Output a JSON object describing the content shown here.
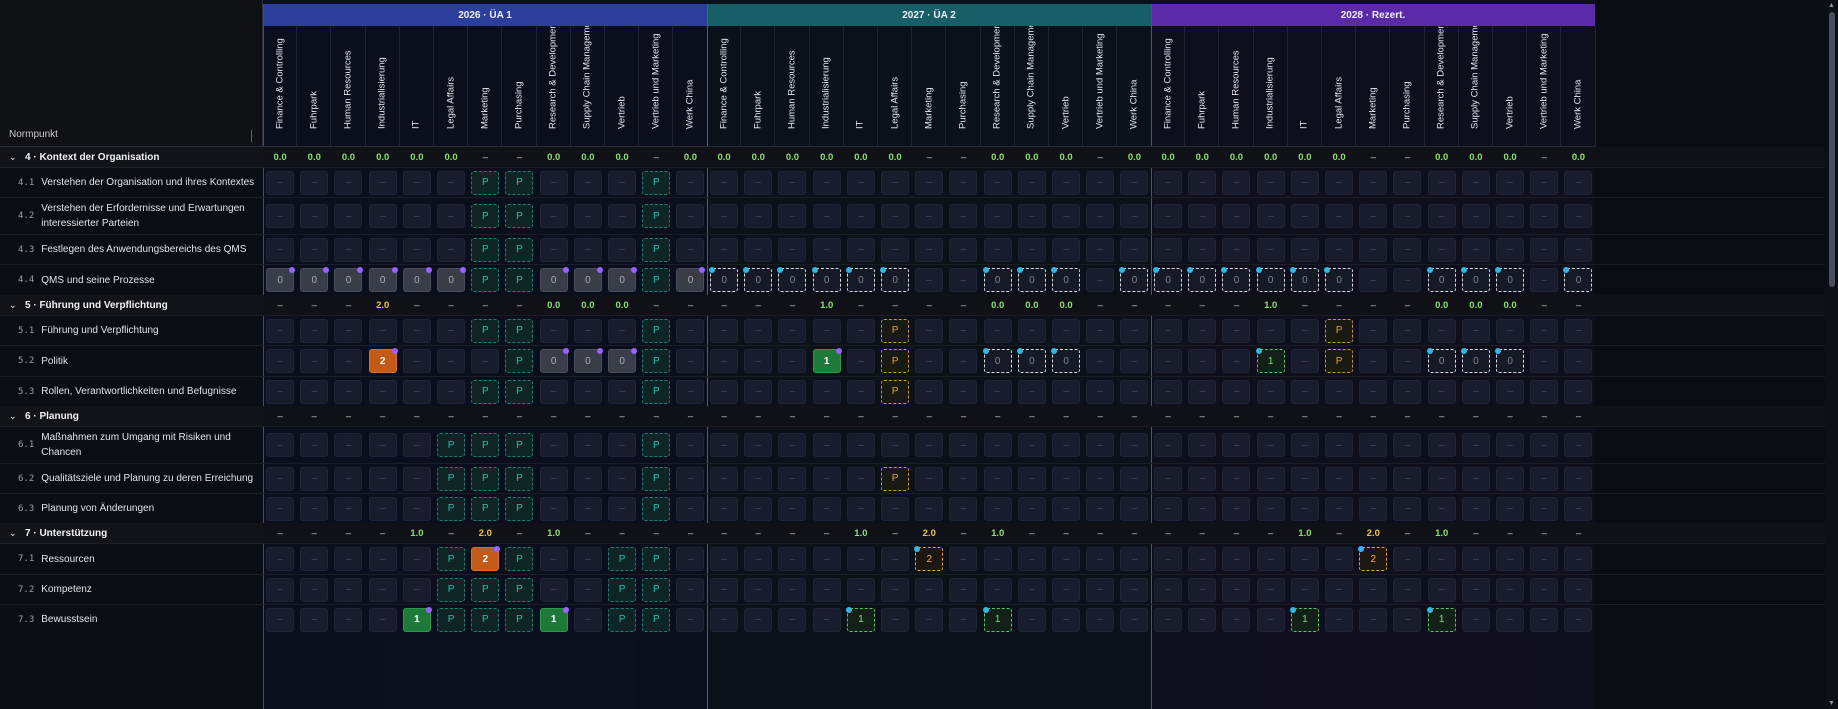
{
  "corner_label": "Normpunkt",
  "groups": [
    {
      "label": "2026 · ÜA 1",
      "color": "#2b3e9c",
      "tint": "rgba(40,70,180,0.06)",
      "line": "#2d4bb8"
    },
    {
      "label": "2027 · ÜA 2",
      "color": "#175e66",
      "tint": "rgba(20,110,120,0.06)",
      "line": "#1b7780"
    },
    {
      "label": "2028 · Rezert.",
      "color": "#5a2aa8",
      "tint": "rgba(110,50,190,0.06)",
      "line": "#6c34c4"
    }
  ],
  "columns": [
    "Finance & Controlling",
    "Fuhrpark",
    "Human Resources",
    "Industrialisierung",
    "IT",
    "Legal Affairs",
    "Marketing",
    "Purchasing",
    "Research & Development",
    "Supply Chain Management",
    "Vertrieb",
    "Vertrieb und Marketing",
    "Werk China"
  ],
  "rows": [
    {
      "type": "section",
      "label": "4 · Kontext der Organisation",
      "g": [
        [
          "0.0",
          "0.0",
          "0.0",
          "0.0",
          "0.0",
          "0.0",
          "–",
          "–",
          "0.0",
          "0.0",
          "0.0",
          "–",
          "0.0"
        ],
        [
          "0.0",
          "0.0",
          "0.0",
          "0.0",
          "0.0",
          "0.0",
          "–",
          "–",
          "0.0",
          "0.0",
          "0.0",
          "–",
          "0.0"
        ],
        [
          "0.0",
          "0.0",
          "0.0",
          "0.0",
          "0.0",
          "0.0",
          "–",
          "–",
          "0.0",
          "0.0",
          "0.0",
          "–",
          "0.0"
        ]
      ]
    },
    {
      "type": "item",
      "num": "4.1",
      "label": "Verstehen der Organisation und ihres Kontextes",
      "h": 30,
      "g": [
        [
          "e",
          "e",
          "e",
          "e",
          "e",
          "e",
          "p",
          "p",
          "e",
          "e",
          "e",
          "p",
          "e"
        ],
        [
          "e",
          "e",
          "e",
          "e",
          "e",
          "e",
          "e",
          "e",
          "e",
          "e",
          "e",
          "e",
          "e"
        ],
        [
          "e",
          "e",
          "e",
          "e",
          "e",
          "e",
          "e",
          "e",
          "e",
          "e",
          "e",
          "e",
          "e"
        ]
      ]
    },
    {
      "type": "item",
      "num": "4.2",
      "label": "Verstehen der Erfordernisse und Erwartungen interessierter Parteien",
      "h": 37,
      "g": [
        [
          "e",
          "e",
          "e",
          "e",
          "e",
          "e",
          "p",
          "p",
          "e",
          "e",
          "e",
          "p",
          "e"
        ],
        [
          "e",
          "e",
          "e",
          "e",
          "e",
          "e",
          "e",
          "e",
          "e",
          "e",
          "e",
          "e",
          "e"
        ],
        [
          "e",
          "e",
          "e",
          "e",
          "e",
          "e",
          "e",
          "e",
          "e",
          "e",
          "e",
          "e",
          "e"
        ]
      ]
    },
    {
      "type": "item",
      "num": "4.3",
      "label": "Festlegen des Anwendungsbereichs des QMS",
      "h": 30,
      "g": [
        [
          "e",
          "e",
          "e",
          "e",
          "e",
          "e",
          "p",
          "p",
          "e",
          "e",
          "e",
          "p",
          "e"
        ],
        [
          "e",
          "e",
          "e",
          "e",
          "e",
          "e",
          "e",
          "e",
          "e",
          "e",
          "e",
          "e",
          "e"
        ],
        [
          "e",
          "e",
          "e",
          "e",
          "e",
          "e",
          "e",
          "e",
          "e",
          "e",
          "e",
          "e",
          "e"
        ]
      ]
    },
    {
      "type": "item",
      "num": "4.4",
      "label": "QMS und seine Prozesse",
      "h": 31,
      "g": [
        [
          "z",
          "z",
          "z",
          "z",
          "z",
          "z",
          "p",
          "p",
          "z",
          "z",
          "z",
          "p",
          "z"
        ],
        [
          "zd",
          "zd",
          "zd",
          "zd",
          "zd",
          "zd",
          "e",
          "e",
          "zd",
          "zd",
          "zd",
          "e",
          "zd"
        ],
        [
          "zd",
          "zd",
          "zd",
          "zd",
          "zd",
          "zd",
          "e",
          "e",
          "zd",
          "zd",
          "zd",
          "e",
          "zd"
        ]
      ]
    },
    {
      "type": "section",
      "label": "5 · Führung und Verpflichtung",
      "g": [
        [
          "–",
          "–",
          "–",
          "2.0",
          "–",
          "–",
          "–",
          "–",
          "0.0",
          "0.0",
          "0.0",
          "–",
          "–"
        ],
        [
          "–",
          "–",
          "–",
          "1.0",
          "–",
          "–",
          "–",
          "–",
          "0.0",
          "0.0",
          "0.0",
          "–",
          "–"
        ],
        [
          "–",
          "–",
          "–",
          "1.0",
          "–",
          "–",
          "–",
          "–",
          "0.0",
          "0.0",
          "0.0",
          "–",
          "–"
        ]
      ]
    },
    {
      "type": "item",
      "num": "5.1",
      "label": "Führung und Verpflichtung",
      "h": 30,
      "g": [
        [
          "e",
          "e",
          "e",
          "e",
          "e",
          "e",
          "p",
          "p",
          "e",
          "e",
          "e",
          "p",
          "e"
        ],
        [
          "e",
          "e",
          "e",
          "e",
          "e",
          "py",
          "e",
          "e",
          "e",
          "e",
          "e",
          "e",
          "e"
        ],
        [
          "e",
          "e",
          "e",
          "e",
          "e",
          "py",
          "e",
          "e",
          "e",
          "e",
          "e",
          "e",
          "e"
        ]
      ]
    },
    {
      "type": "item",
      "num": "5.2",
      "label": "Politik",
      "h": 31,
      "g": [
        [
          "e",
          "e",
          "e",
          "two",
          "e",
          "e",
          "e",
          "p",
          "z",
          "z",
          "z",
          "p",
          "e"
        ],
        [
          "e",
          "e",
          "e",
          "one",
          "e",
          "py",
          "e",
          "e",
          "zd",
          "zd",
          "zd",
          "e",
          "e"
        ],
        [
          "e",
          "e",
          "e",
          "d1",
          "e",
          "py",
          "e",
          "e",
          "zd",
          "zd",
          "zd",
          "e",
          "e"
        ]
      ]
    },
    {
      "type": "item",
      "num": "5.3",
      "label": "Rollen, Verantwortlichkeiten und Befugnisse",
      "h": 30,
      "g": [
        [
          "e",
          "e",
          "e",
          "e",
          "e",
          "e",
          "p",
          "p",
          "e",
          "e",
          "e",
          "p",
          "e"
        ],
        [
          "e",
          "e",
          "e",
          "e",
          "e",
          "py",
          "e",
          "e",
          "e",
          "e",
          "e",
          "e",
          "e"
        ],
        [
          "e",
          "e",
          "e",
          "e",
          "e",
          "e",
          "e",
          "e",
          "e",
          "e",
          "e",
          "e",
          "e"
        ]
      ]
    },
    {
      "type": "section",
      "label": "6 · Planung",
      "g": [
        [
          "–",
          "–",
          "–",
          "–",
          "–",
          "–",
          "–",
          "–",
          "–",
          "–",
          "–",
          "–",
          "–"
        ],
        [
          "–",
          "–",
          "–",
          "–",
          "–",
          "–",
          "–",
          "–",
          "–",
          "–",
          "–",
          "–",
          "–"
        ],
        [
          "–",
          "–",
          "–",
          "–",
          "–",
          "–",
          "–",
          "–",
          "–",
          "–",
          "–",
          "–",
          "–"
        ]
      ]
    },
    {
      "type": "item",
      "num": "6.1",
      "label": "Maßnahmen zum Umgang mit Risiken und Chancen",
      "h": 37,
      "g": [
        [
          "e",
          "e",
          "e",
          "e",
          "e",
          "p",
          "p",
          "p",
          "e",
          "e",
          "e",
          "p",
          "e"
        ],
        [
          "e",
          "e",
          "e",
          "e",
          "e",
          "e",
          "e",
          "e",
          "e",
          "e",
          "e",
          "e",
          "e"
        ],
        [
          "e",
          "e",
          "e",
          "e",
          "e",
          "e",
          "e",
          "e",
          "e",
          "e",
          "e",
          "e",
          "e"
        ]
      ]
    },
    {
      "type": "item",
      "num": "6.2",
      "label": "Qualitätsziele und Planung zu deren Erreichung",
      "h": 30,
      "g": [
        [
          "e",
          "e",
          "e",
          "e",
          "e",
          "p",
          "p",
          "p",
          "e",
          "e",
          "e",
          "p",
          "e"
        ],
        [
          "e",
          "e",
          "e",
          "e",
          "e",
          "py",
          "e",
          "e",
          "e",
          "e",
          "e",
          "e",
          "e"
        ],
        [
          "e",
          "e",
          "e",
          "e",
          "e",
          "e",
          "e",
          "e",
          "e",
          "e",
          "e",
          "e",
          "e"
        ]
      ]
    },
    {
      "type": "item",
      "num": "6.3",
      "label": "Planung von Änderungen",
      "h": 30,
      "g": [
        [
          "e",
          "e",
          "e",
          "e",
          "e",
          "p",
          "p",
          "p",
          "e",
          "e",
          "e",
          "p",
          "e"
        ],
        [
          "e",
          "e",
          "e",
          "e",
          "e",
          "e",
          "e",
          "e",
          "e",
          "e",
          "e",
          "e",
          "e"
        ],
        [
          "e",
          "e",
          "e",
          "e",
          "e",
          "e",
          "e",
          "e",
          "e",
          "e",
          "e",
          "e",
          "e"
        ]
      ]
    },
    {
      "type": "section",
      "label": "7 · Unterstützung",
      "g": [
        [
          "–",
          "–",
          "–",
          "–",
          "1.0",
          "–",
          "2.0",
          "–",
          "1.0",
          "–",
          "–",
          "–",
          "–"
        ],
        [
          "–",
          "–",
          "–",
          "–",
          "1.0",
          "–",
          "2.0",
          "–",
          "1.0",
          "–",
          "–",
          "–",
          "–"
        ],
        [
          "–",
          "–",
          "–",
          "–",
          "1.0",
          "–",
          "2.0",
          "–",
          "1.0",
          "–",
          "–",
          "–",
          "–"
        ]
      ]
    },
    {
      "type": "item",
      "num": "7.1",
      "label": "Ressourcen",
      "h": 31,
      "g": [
        [
          "e",
          "e",
          "e",
          "e",
          "e",
          "p",
          "two",
          "p",
          "e",
          "e",
          "p",
          "p",
          "e"
        ],
        [
          "e",
          "e",
          "e",
          "e",
          "e",
          "e",
          "d2",
          "e",
          "e",
          "e",
          "e",
          "e",
          "e"
        ],
        [
          "e",
          "e",
          "e",
          "e",
          "e",
          "e",
          "d2",
          "e",
          "e",
          "e",
          "e",
          "e",
          "e"
        ]
      ]
    },
    {
      "type": "item",
      "num": "7.2",
      "label": "Kompetenz",
      "h": 30,
      "g": [
        [
          "e",
          "e",
          "e",
          "e",
          "e",
          "p",
          "p",
          "p",
          "e",
          "e",
          "p",
          "p",
          "e"
        ],
        [
          "e",
          "e",
          "e",
          "e",
          "e",
          "e",
          "e",
          "e",
          "e",
          "e",
          "e",
          "e",
          "e"
        ],
        [
          "e",
          "e",
          "e",
          "e",
          "e",
          "e",
          "e",
          "e",
          "e",
          "e",
          "e",
          "e",
          "e"
        ]
      ]
    },
    {
      "type": "item",
      "num": "7.3",
      "label": "Bewusstsein",
      "h": 30,
      "g": [
        [
          "e",
          "e",
          "e",
          "e",
          "one",
          "p",
          "p",
          "p",
          "one",
          "e",
          "p",
          "p",
          "e"
        ],
        [
          "e",
          "e",
          "e",
          "e",
          "d1",
          "e",
          "e",
          "e",
          "d1",
          "e",
          "e",
          "e",
          "e"
        ],
        [
          "e",
          "e",
          "e",
          "e",
          "d1",
          "e",
          "e",
          "e",
          "d1",
          "e",
          "e",
          "e",
          "e"
        ]
      ]
    }
  ],
  "cell_text": {
    "e": "–",
    "p": "P",
    "py": "P",
    "z": "0",
    "zd": "0",
    "two": "2",
    "one": "1",
    "d1": "1",
    "d2": "2"
  },
  "scroll": {
    "up": "▲",
    "down": "▼"
  }
}
